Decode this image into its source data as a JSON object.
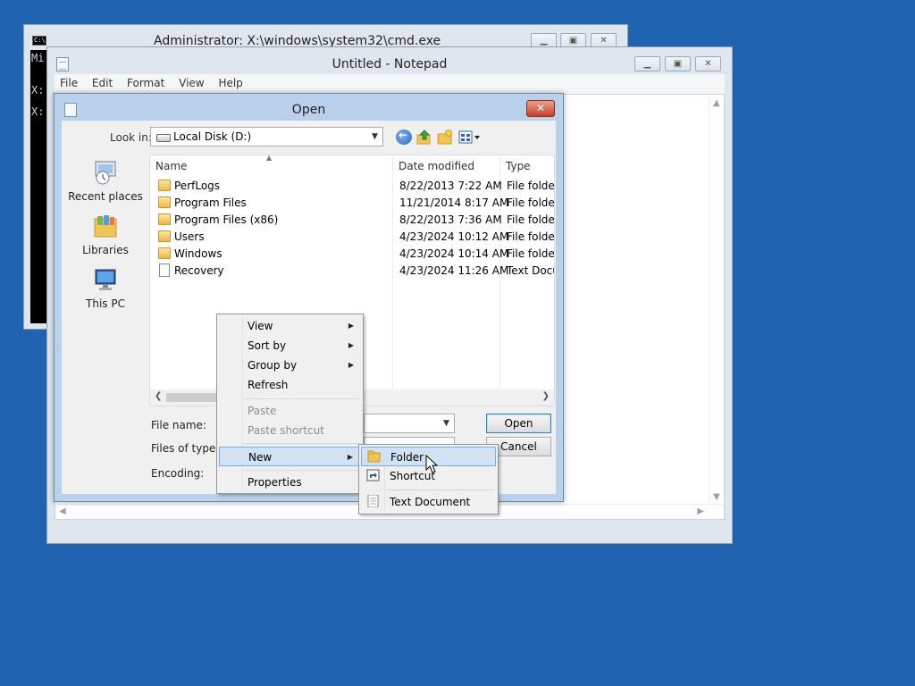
{
  "cmd": {
    "title": "Administrator: X:\\windows\\system32\\cmd.exe",
    "icon_text": "C:\\.",
    "console_lines": [
      "Mi",
      "X:",
      "X:"
    ]
  },
  "notepad": {
    "title": "Untitled - Notepad",
    "menu": [
      "File",
      "Edit",
      "Format",
      "View",
      "Help"
    ]
  },
  "dialog": {
    "title": "Open",
    "close_glyph": "✕",
    "look_in_label": "Look in:",
    "look_in_value": "Local Disk (D:)",
    "places": [
      {
        "label": "Recent places",
        "icon": "recent-places-icon"
      },
      {
        "label": "Libraries",
        "icon": "libraries-icon"
      },
      {
        "label": "This PC",
        "icon": "this-pc-icon"
      }
    ],
    "columns": [
      "Name",
      "Date modified",
      "Type"
    ],
    "files": [
      {
        "name": "PerfLogs",
        "date": "8/22/2013 7:22 AM",
        "type": "File folder",
        "icon": "folder-icon"
      },
      {
        "name": "Program Files",
        "date": "11/21/2014 8:17 AM",
        "type": "File folder",
        "icon": "folder-icon"
      },
      {
        "name": "Program Files (x86)",
        "date": "8/22/2013 7:36 AM",
        "type": "File folder",
        "icon": "folder-icon"
      },
      {
        "name": "Users",
        "date": "4/23/2024 10:12 AM",
        "type": "File folder",
        "icon": "folder-icon"
      },
      {
        "name": "Windows",
        "date": "4/23/2024 10:14 AM",
        "type": "File folder",
        "icon": "folder-icon"
      },
      {
        "name": "Recovery",
        "date": "4/23/2024 11:26 AM",
        "type": "Text Docu",
        "icon": "file-icon"
      }
    ],
    "file_name_label": "File name:",
    "files_of_type_label": "Files of type:",
    "encoding_label": "Encoding:",
    "open_button": "Open",
    "cancel_button": "Cancel"
  },
  "context_menu": {
    "items": [
      {
        "label": "View",
        "submenu": true,
        "enabled": true
      },
      {
        "label": "Sort by",
        "submenu": true,
        "enabled": true
      },
      {
        "label": "Group by",
        "submenu": true,
        "enabled": true
      },
      {
        "label": "Refresh",
        "submenu": false,
        "enabled": true
      },
      {
        "label": "Paste",
        "submenu": false,
        "enabled": false
      },
      {
        "label": "Paste shortcut",
        "submenu": false,
        "enabled": false
      },
      {
        "label": "New",
        "submenu": true,
        "enabled": true,
        "highlighted": true
      },
      {
        "label": "Properties",
        "submenu": false,
        "enabled": true
      }
    ]
  },
  "new_submenu": {
    "items": [
      {
        "label": "Folder",
        "icon": "folder-icon",
        "highlighted": true
      },
      {
        "label": "Shortcut",
        "icon": "shortcut-icon"
      },
      {
        "label": "Text Document",
        "icon": "text-document-icon"
      }
    ]
  },
  "colors": {
    "desktop": "#1f63b0",
    "dialog_frame": "#b9d1ea",
    "close_button": "#c7412b",
    "menu_highlight": "#d1e2f2"
  }
}
